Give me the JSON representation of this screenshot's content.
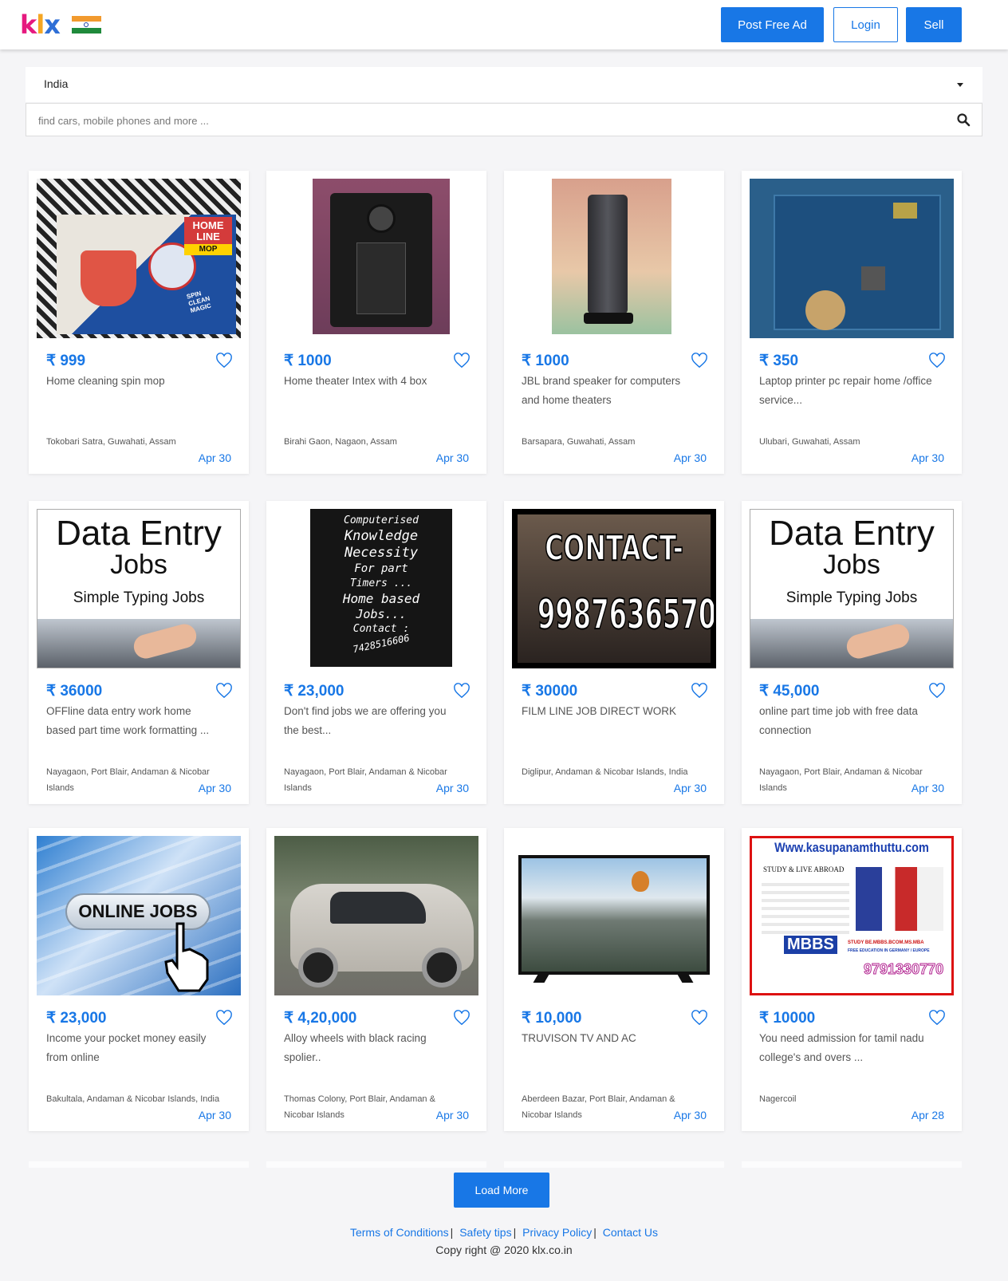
{
  "header": {
    "logo": {
      "k": "k",
      "l": "l",
      "x": "x"
    },
    "post_free_ad": "Post Free Ad",
    "login": "Login",
    "sell": "Sell"
  },
  "location": {
    "selected": "India"
  },
  "search": {
    "placeholder": "find cars, mobile phones and more ..."
  },
  "listings": [
    {
      "price": "₹ 999",
      "title": "Home cleaning spin mop",
      "location": "Tokobari Satra, Guwahati, Assam",
      "date": "Apr 30"
    },
    {
      "price": "₹ 1000",
      "title": "Home theater Intex with 4 box",
      "location": "Birahi Gaon, Nagaon, Assam",
      "date": "Apr 30"
    },
    {
      "price": "₹ 1000",
      "title": "JBL brand speaker for computers and home theaters",
      "location": "Barsapara, Guwahati, Assam",
      "date": "Apr 30"
    },
    {
      "price": "₹ 350",
      "title": "Laptop printer pc repair home /office service...",
      "location": "Ulubari, Guwahati, Assam",
      "date": "Apr 30"
    },
    {
      "price": "₹ 36000",
      "title": "OFFline data entry work home based part time work formatting ...",
      "location": "Nayagaon, Port Blair, Andaman & Nicobar Islands",
      "date": "Apr 30"
    },
    {
      "price": "₹ 23,000",
      "title": "Don't find jobs we are offering you the best...",
      "location": "Nayagaon, Port Blair, Andaman & Nicobar Islands",
      "date": "Apr 30"
    },
    {
      "price": "₹ 30000",
      "title": "FILM LINE JOB DIRECT WORK",
      "location": "Diglipur, Andaman & Nicobar Islands, India",
      "date": "Apr 30"
    },
    {
      "price": "₹ 45,000",
      "title": "online part time job with free data connection",
      "location": "Nayagaon, Port Blair, Andaman & Nicobar Islands",
      "date": "Apr 30"
    },
    {
      "price": "₹ 23,000",
      "title": "Income your pocket money easily from online",
      "location": "Bakultala, Andaman & Nicobar Islands, India",
      "date": "Apr 30"
    },
    {
      "price": "₹ 4,20,000",
      "title": "Alloy wheels with black racing spolier..",
      "location": "Thomas Colony, Port Blair, Andaman & Nicobar Islands",
      "date": "Apr 30"
    },
    {
      "price": "₹ 10,000",
      "title": "TRUVISON TV AND AC",
      "location": "Aberdeen Bazar, Port Blair, Andaman & Nicobar Islands",
      "date": "Apr 30"
    },
    {
      "price": "₹ 10000",
      "title": "You need admission for tamil nadu college's and overs ...",
      "location": "Nagercoil",
      "date": "Apr 28"
    }
  ],
  "image_text": {
    "mop": {
      "brand1": "HOME",
      "brand2": "LINE",
      "brand3": "MOP",
      "spin": "SPIN",
      "clean": "CLEAN",
      "magic": "MAGIC"
    },
    "data_entry": {
      "line1": "Data Entry",
      "line2": "Jobs",
      "line3": "Simple Typing Jobs"
    },
    "computerised": [
      "Computerised",
      "Knowledge",
      "Necessity",
      "For part",
      "Timers ...",
      "Home based",
      "Jobs...",
      "Contact :",
      "7428516606"
    ],
    "contact": {
      "line1": "CONTACT-",
      "line2": "9987636570"
    },
    "online_jobs": "ONLINE JOBS",
    "study": {
      "url": "Www.kasupanamthuttu.com",
      "heading": "STUDY & LIVE ABROAD",
      "mbbs": "MBBS",
      "study_line": "STUDY BE.MBBS.BCOM.MS.MBA",
      "free_line": "FREE EDUCATION IN GERMANY / EUROPE",
      "phone": "9791330770"
    }
  },
  "load_more": "Load More",
  "footer": {
    "links": [
      "Terms of Conditions",
      "Safety tips",
      "Privacy Policy",
      "Contact Us"
    ],
    "copyright": "Copy right @ 2020 klx.co.in"
  },
  "colors": {
    "accent": "#1877e6",
    "background": "#f5f5f7"
  }
}
